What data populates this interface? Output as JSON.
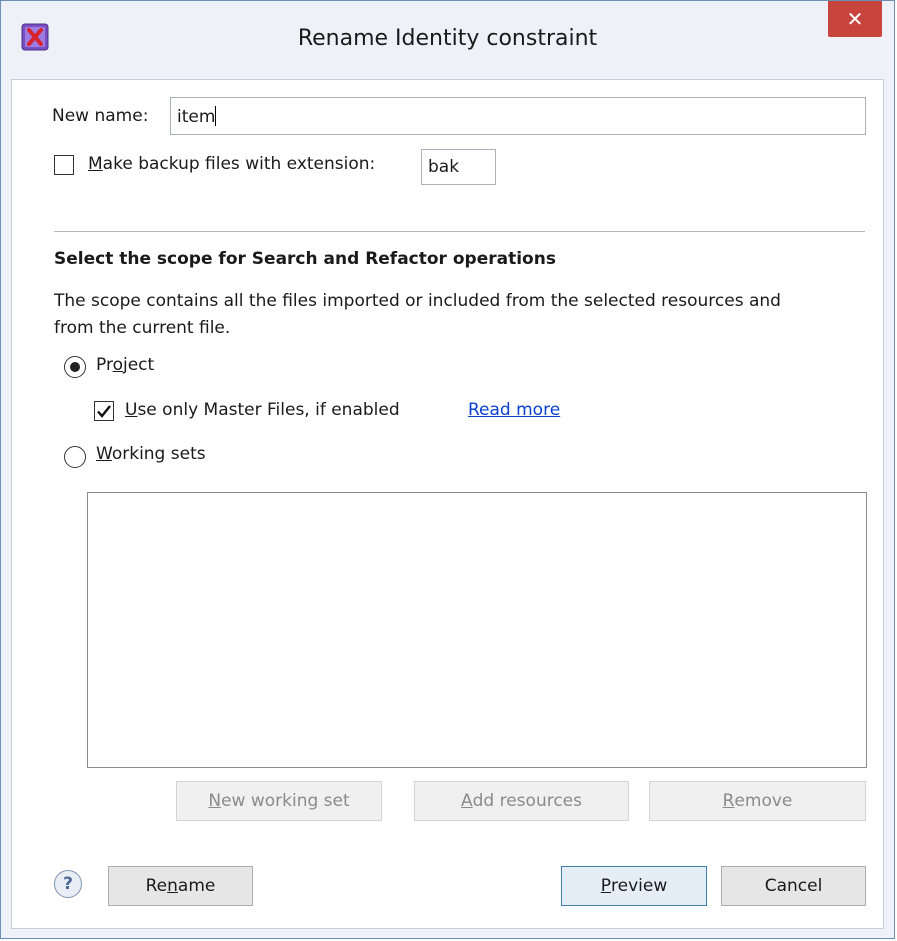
{
  "window": {
    "title": "Rename Identity constraint",
    "close_glyph": "✕"
  },
  "new_name": {
    "label": "New name:",
    "value": "item"
  },
  "backup": {
    "label": "Make backup files with extension:",
    "mnemonic": "M",
    "rest": "ake backup files with extension:",
    "checked": false,
    "value": "bak"
  },
  "scope": {
    "heading": "Select the scope for Search and Refactor operations",
    "description_line1": "The scope contains all the files imported or included from the selected resources and",
    "description_line2": "from the current file.",
    "project": {
      "pre": "Pr",
      "mnemonic": "o",
      "post": "ject",
      "selected": true
    },
    "master_files": {
      "mnemonic": "U",
      "rest": "se only Master Files, if enabled",
      "checked": true
    },
    "read_more": "Read more",
    "working_sets": {
      "mnemonic": "W",
      "rest": "orking sets",
      "selected": false
    }
  },
  "list_buttons": {
    "new_working_set": {
      "mnemonic": "N",
      "rest": "ew working set"
    },
    "add_resources": {
      "mnemonic": "A",
      "rest": "dd resources"
    },
    "remove": {
      "mnemonic": "R",
      "rest": "emove"
    }
  },
  "footer": {
    "help": "?",
    "rename": {
      "pre": "Re",
      "mnemonic": "n",
      "post": "ame"
    },
    "preview": {
      "mnemonic": "P",
      "rest": "review"
    },
    "cancel": "Cancel"
  },
  "colors": {
    "close": "#c7453c",
    "link": "#0b3fd1",
    "border": "#6e8fb5"
  }
}
